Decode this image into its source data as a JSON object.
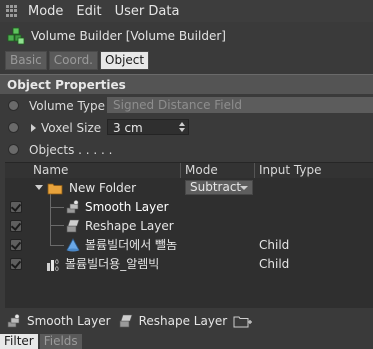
{
  "menu": {
    "items": [
      "Mode",
      "Edit",
      "User Data"
    ]
  },
  "title": {
    "text": "Volume Builder [Volume Builder]"
  },
  "tabs": [
    {
      "label": "Basic",
      "active": false
    },
    {
      "label": "Coord.",
      "active": false
    },
    {
      "label": "Object",
      "active": true
    }
  ],
  "section": {
    "title": "Object Properties"
  },
  "properties": {
    "volume_type": {
      "label": "Volume Type",
      "value": "Signed Distance Field"
    },
    "voxel_size": {
      "label": "Voxel Size",
      "value": "3 cm"
    },
    "objects": {
      "label": "Objects . . . . ."
    }
  },
  "list": {
    "columns": [
      "Name",
      "Mode",
      "Input Type"
    ],
    "rows": [
      {
        "name": "New Folder",
        "mode": "Subtract",
        "input_type": "",
        "icon": "folder-icon"
      },
      {
        "name": "Smooth Layer",
        "mode": "",
        "input_type": "",
        "icon": "smooth-layer-icon"
      },
      {
        "name": "Reshape Layer",
        "mode": "",
        "input_type": "",
        "icon": "reshape-layer-icon"
      },
      {
        "name": "볼륨빌더에서 뺄놈",
        "mode": "",
        "input_type": "Child",
        "icon": "cone-icon"
      },
      {
        "name": "볼륨빌더용_알렘빅",
        "mode": "",
        "input_type": "Child",
        "icon": "null-object-icon"
      }
    ]
  },
  "bottom_buttons": {
    "smooth_layer": "Smooth Layer",
    "reshape_layer": "Reshape Layer"
  },
  "bottom_tabs": [
    {
      "label": "Filter",
      "active": true
    },
    {
      "label": "Fields",
      "active": false
    }
  ],
  "colors": {
    "panel_bg": "#3a3a3a",
    "list_bg": "#2f2f2f",
    "active_tab": "#e8e8e8",
    "folder_icon": "#e8a33c",
    "volume_icon": "#4caf50",
    "cone_icon": "#6aa8e8"
  }
}
